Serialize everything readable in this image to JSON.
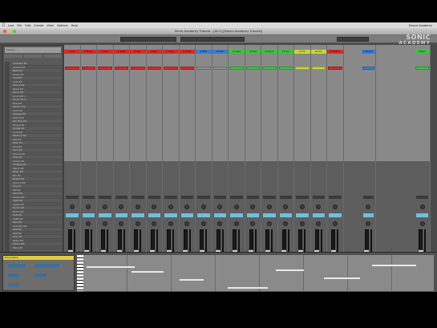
{
  "menubar": {
    "items": [
      "Live",
      "File",
      "Edit",
      "Create",
      "View",
      "Options",
      "Help"
    ],
    "right_text": "Dance Academy"
  },
  "window": {
    "title": "Drum Academy Tutorial - [AC1] [Dance Academy Tutorial]"
  },
  "logo": {
    "line1": "SONIC",
    "line2": "ACADEMY"
  },
  "browser": {
    "search_placeholder": "Search",
    "items": [
      "Ambient Kit",
      "Analog Kit",
      "Beat Kit",
      "Break Kit",
      "Chill Kit",
      "Club Kit",
      "Dance Kit",
      "Deep Kit",
      "Disco Kit",
      "Drum Kit 1",
      "Drum Kit 2",
      "Dub Kit",
      "Electro Kit",
      "Funk Kit",
      "Garage Kit",
      "Glitch Kit",
      "Hip Hop Kit",
      "House Kit",
      "Jungle Kit",
      "Lo-Fi Kit",
      "Minimal Kit",
      "Pop Kit",
      "Rock Kit",
      "Soul Kit",
      "Tech Kit",
      "Trance Kit",
      "Trap Kit",
      "Urban Kit",
      "Vintage Kit",
      "Warm Kit",
      "Basic Kit",
      "Big Kit",
      "Bright Kit",
      "Crunch Kit",
      "Dry Kit",
      "Fat Kit",
      "Hard Kit",
      "Heavy Kit",
      "Light Kit",
      "Loose Kit",
      "Punch Kit",
      "Room Kit",
      "Soft Kit",
      "Tight Kit",
      "Wet Kit",
      "Acoustic Kit",
      "808 Kit",
      "909 Kit",
      "Linn Kit",
      "Retro Kit",
      "Studio Kit",
      "Tape Kit"
    ]
  },
  "tracks": [
    {
      "name": "1 Kick",
      "color": "#d62a2a",
      "clip": "#d62a2a",
      "meter": 0.0
    },
    {
      "name": "2 Snare",
      "color": "#d62a2a",
      "clip": "#d62a2a",
      "meter": 0.0
    },
    {
      "name": "3 Clap",
      "color": "#d62a2a",
      "clip": "#d62a2a",
      "meter": 0.0
    },
    {
      "name": "4 HiHat",
      "color": "#d62a2a",
      "clip": "#d62a2a",
      "meter": 0.0
    },
    {
      "name": "5 Perc",
      "color": "#d62a2a",
      "clip": "#d62a2a",
      "meter": 0.0
    },
    {
      "name": "6 Tom",
      "color": "#d62a2a",
      "clip": "#d62a2a",
      "meter": 0.0
    },
    {
      "name": "7 Ride",
      "color": "#d62a2a",
      "clip": "#d62a2a",
      "meter": 0.0
    },
    {
      "name": "8 Crash",
      "color": "#d62a2a",
      "clip": "#d62a2a",
      "meter": 0.0
    },
    {
      "name": "9 Bass",
      "color": "#3a7bd5",
      "clip": "#8e8e8e",
      "meter": 0.0
    },
    {
      "name": "10 Sub",
      "color": "#3a7bd5",
      "clip": "#8e8e8e",
      "meter": 0.0
    },
    {
      "name": "11 Lead",
      "color": "#3cc43c",
      "clip": "#3cc43c",
      "meter": 0.0
    },
    {
      "name": "12 Pad",
      "color": "#3cc43c",
      "clip": "#3cc43c",
      "meter": 0.0
    },
    {
      "name": "13 Pluck",
      "color": "#3cc43c",
      "clip": "#3cc43c",
      "meter": 0.0
    },
    {
      "name": "14 Arp",
      "color": "#3cc43c",
      "clip": "#3cc43c",
      "meter": 0.0
    },
    {
      "name": "15 FX",
      "color": "#c8d43c",
      "clip": "#c8d43c",
      "meter": 0.0
    },
    {
      "name": "16 Vox",
      "color": "#c8d43c",
      "clip": "#c8d43c",
      "meter": 0.0
    },
    {
      "name": "17 Return",
      "color": "#d62a2a",
      "clip": "#d62a2a",
      "meter": 0.0
    },
    {
      "name": "A Reverb",
      "color": "#3a7bd5",
      "clip": "#3a7bd5",
      "meter": 0.0
    },
    {
      "name": "Master",
      "color": "#3cc43c",
      "clip": "#3cc43c",
      "meter": 0.42
    }
  ],
  "colors": {
    "meter_green": "#3ee06a",
    "volume_blue": "#6fbfe0",
    "panel": "#5d5d5d"
  },
  "detail": {
    "device_title": "Drum Rack"
  }
}
